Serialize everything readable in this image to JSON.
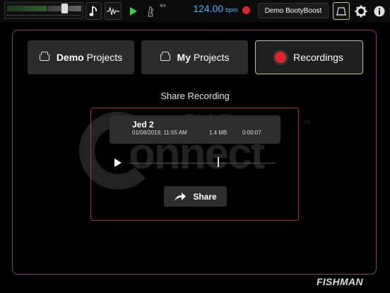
{
  "toolbar": {
    "time_signature": "4/4",
    "tempo_value": "124.00",
    "tempo_unit": "bpm",
    "song_name": "Demo BootyBoost",
    "icons": [
      "level-meter",
      "music-note-icon",
      "waveform-icon",
      "play-icon",
      "metronome-icon",
      "record-icon",
      "drum-pad-icon",
      "gear-icon",
      "info-icon"
    ]
  },
  "tabs": [
    {
      "lead": "Demo",
      "rest": " Projects",
      "icon": "folder-icon",
      "active": false
    },
    {
      "lead": "My",
      "rest": " Projects",
      "icon": "folder-icon",
      "active": false
    },
    {
      "lead": "",
      "rest": "Recordings",
      "icon": "record-icon",
      "active": true
    }
  ],
  "share": {
    "title": "Share Recording",
    "recording": {
      "name": "Jed 2",
      "date": "01/08/2019, 11:55 AM",
      "size": "1.4 MB",
      "duration": "0:00:07"
    },
    "button_label": "Share",
    "playback_progress": 0.61
  },
  "watermark": {
    "line1": "TripleFlay",
    "line2": "onnect",
    "tm": "TM"
  },
  "brand": "FISHMAN",
  "colors": {
    "accent_blue": "#4db7ff",
    "record_red": "#e0242b",
    "panel_border": "#8a3b7c",
    "box_border": "#a8333a",
    "active_tab_border": "#b9c98a"
  }
}
